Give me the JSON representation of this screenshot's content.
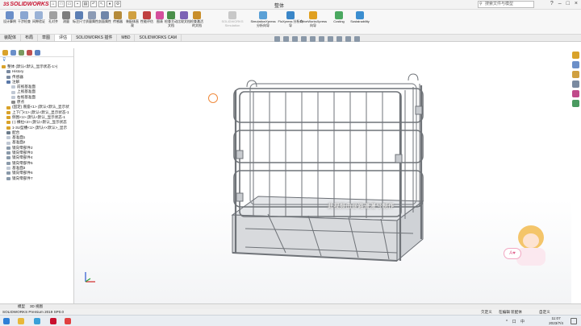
{
  "app": {
    "logo_prefix": "3S",
    "logo_text": "SOLIDWORKS",
    "title": "整体",
    "search_placeholder": "搜索文件与模型",
    "window_controls": [
      "?",
      "–",
      "□",
      "×"
    ]
  },
  "ribbon": {
    "buttons": [
      {
        "label": "设计算例",
        "icon": "design-study-icon",
        "color": "#6b8fc9",
        "enabled": true
      },
      {
        "label": "干涉检查",
        "icon": "interference-icon",
        "color": "#8aa6d1",
        "enabled": true
      },
      {
        "label": "间隙验证",
        "icon": "clearance-icon",
        "color": "#9ab2d6",
        "enabled": true
      },
      {
        "label": "孔对齐",
        "icon": "hole-align-icon",
        "color": "#a0a0a0",
        "enabled": true
      },
      {
        "label": "测量",
        "icon": "measure-icon",
        "color": "#7d7d7d",
        "enabled": true
      },
      {
        "label": "标注尺寸",
        "icon": "dimension-icon",
        "color": "#5c7fb4",
        "enabled": true
      },
      {
        "label": "质量属性",
        "icon": "mass-props-icon",
        "color": "#8c9bb5",
        "enabled": true
      },
      {
        "label": "剖面属性",
        "icon": "section-props-icon",
        "color": "#6f86aa",
        "enabled": true
      },
      {
        "label": "传感器",
        "icon": "sensor-icon",
        "color": "#b58b3a",
        "enabled": true
      },
      {
        "label": "装配体直观",
        "icon": "assembly-visual-icon",
        "color": "#d0a040",
        "enabled": true
      },
      {
        "label": "性能评估",
        "icon": "performance-icon",
        "color": "#c04040",
        "enabled": true
      },
      {
        "label": "图表",
        "icon": "chart-icon",
        "color": "#d44e9c",
        "enabled": true
      },
      {
        "label": "检查主动文档",
        "icon": "check-doc-icon",
        "color": "#4a8f4a",
        "enabled": true
      },
      {
        "label": "比较文档",
        "icon": "compare-icon",
        "color": "#7c62b5",
        "enabled": true
      },
      {
        "label": "检查激活的文档",
        "icon": "check-active-icon",
        "color": "#c98e2a",
        "enabled": true
      },
      {
        "label": "SOLIDWORKS Simulation",
        "icon": "simulation-icon",
        "color": "#c8c8c8",
        "enabled": false
      },
      {
        "label": "SimulationXpress 分析向导",
        "icon": "simxpress-icon",
        "color": "#5aa0d6",
        "enabled": true
      },
      {
        "label": "FloXpress 分析向导",
        "icon": "floxpress-icon",
        "color": "#3a86c8",
        "enabled": true
      },
      {
        "label": "DriveWorksXpress 向导",
        "icon": "driveworks-icon",
        "color": "#e0a020",
        "enabled": true
      },
      {
        "label": "Costing",
        "icon": "costing-icon",
        "color": "#4aa860",
        "enabled": true
      },
      {
        "label": "Sustainability",
        "icon": "sustainability-icon",
        "color": "#3b8ed0",
        "enabled": true
      }
    ]
  },
  "tabs": [
    {
      "label": "装配体",
      "active": false
    },
    {
      "label": "布局",
      "active": false
    },
    {
      "label": "草图",
      "active": false
    },
    {
      "label": "评估",
      "active": true
    },
    {
      "label": "SOLIDWORKS 插件",
      "active": false
    },
    {
      "label": "MBD",
      "active": false
    },
    {
      "label": "SOLIDWORKS CAM",
      "active": false
    }
  ],
  "tree": {
    "filter_icon": "filter-icon",
    "items": [
      {
        "text": "整体 (默认<默认_显示状态-1>)",
        "color": "#d9a22a",
        "indent": 0
      },
      {
        "text": "History",
        "color": "#7a8aa0",
        "indent": 1
      },
      {
        "text": "传感器",
        "color": "#7a8aa0",
        "indent": 1
      },
      {
        "text": "注解",
        "color": "#5a78a8",
        "indent": 1
      },
      {
        "text": "前视基准面",
        "color": "#c0c8d4",
        "indent": 2
      },
      {
        "text": "上视基准面",
        "color": "#c0c8d4",
        "indent": 2
      },
      {
        "text": "右视基准面",
        "color": "#c0c8d4",
        "indent": 2
      },
      {
        "text": "原点",
        "color": "#8a8a8a",
        "indent": 2
      },
      {
        "text": "(固定) 底座<1> (默认<默认_显示状",
        "color": "#d9a22a",
        "indent": 1
      },
      {
        "text": "上下门<1> (默认<默认_显示状态-1",
        "color": "#d9a22a",
        "indent": 1
      },
      {
        "text": "侧围<1> (默认<默认_显示状态-1",
        "color": "#d9a22a",
        "indent": 1
      },
      {
        "text": "(-) 横拉<2> (默认<默认_显示状态",
        "color": "#d9a22a",
        "indent": 1
      },
      {
        "text": "1-3U型槽<1> (默认<<默认>_显示",
        "color": "#d9a22a",
        "indent": 1
      },
      {
        "text": "配合",
        "color": "#6a7a8a",
        "indent": 1
      },
      {
        "text": "基准面1",
        "color": "#c0c8d4",
        "indent": 1
      },
      {
        "text": "基准面2",
        "color": "#c0c8d4",
        "indent": 1
      },
      {
        "text": "镜向零部件2",
        "color": "#8a9aaa",
        "indent": 1
      },
      {
        "text": "镜向零部件3",
        "color": "#8a9aaa",
        "indent": 1
      },
      {
        "text": "镜向零部件4",
        "color": "#8a9aaa",
        "indent": 1
      },
      {
        "text": "镜向零部件5",
        "color": "#8a9aaa",
        "indent": 1
      },
      {
        "text": "基准面3",
        "color": "#c0c8d4",
        "indent": 1
      },
      {
        "text": "镜向零部件6",
        "color": "#8a9aaa",
        "indent": 1
      },
      {
        "text": "镜向零部件7",
        "color": "#8a9aaa",
        "indent": 1
      }
    ]
  },
  "viewport": {
    "watermark": "此视频由@路漫漫兮制作"
  },
  "bottom_tabs": [
    "模型",
    "3D 视图"
  ],
  "status": {
    "version": "SOLIDWORKS Premium 2019 SP0.0",
    "right_items": [
      "欠定义",
      "在编辑 装配体",
      "自定义"
    ]
  },
  "taskbar": {
    "time": "11:07",
    "date": "2023/7/4",
    "tray": "^ 口 中"
  }
}
